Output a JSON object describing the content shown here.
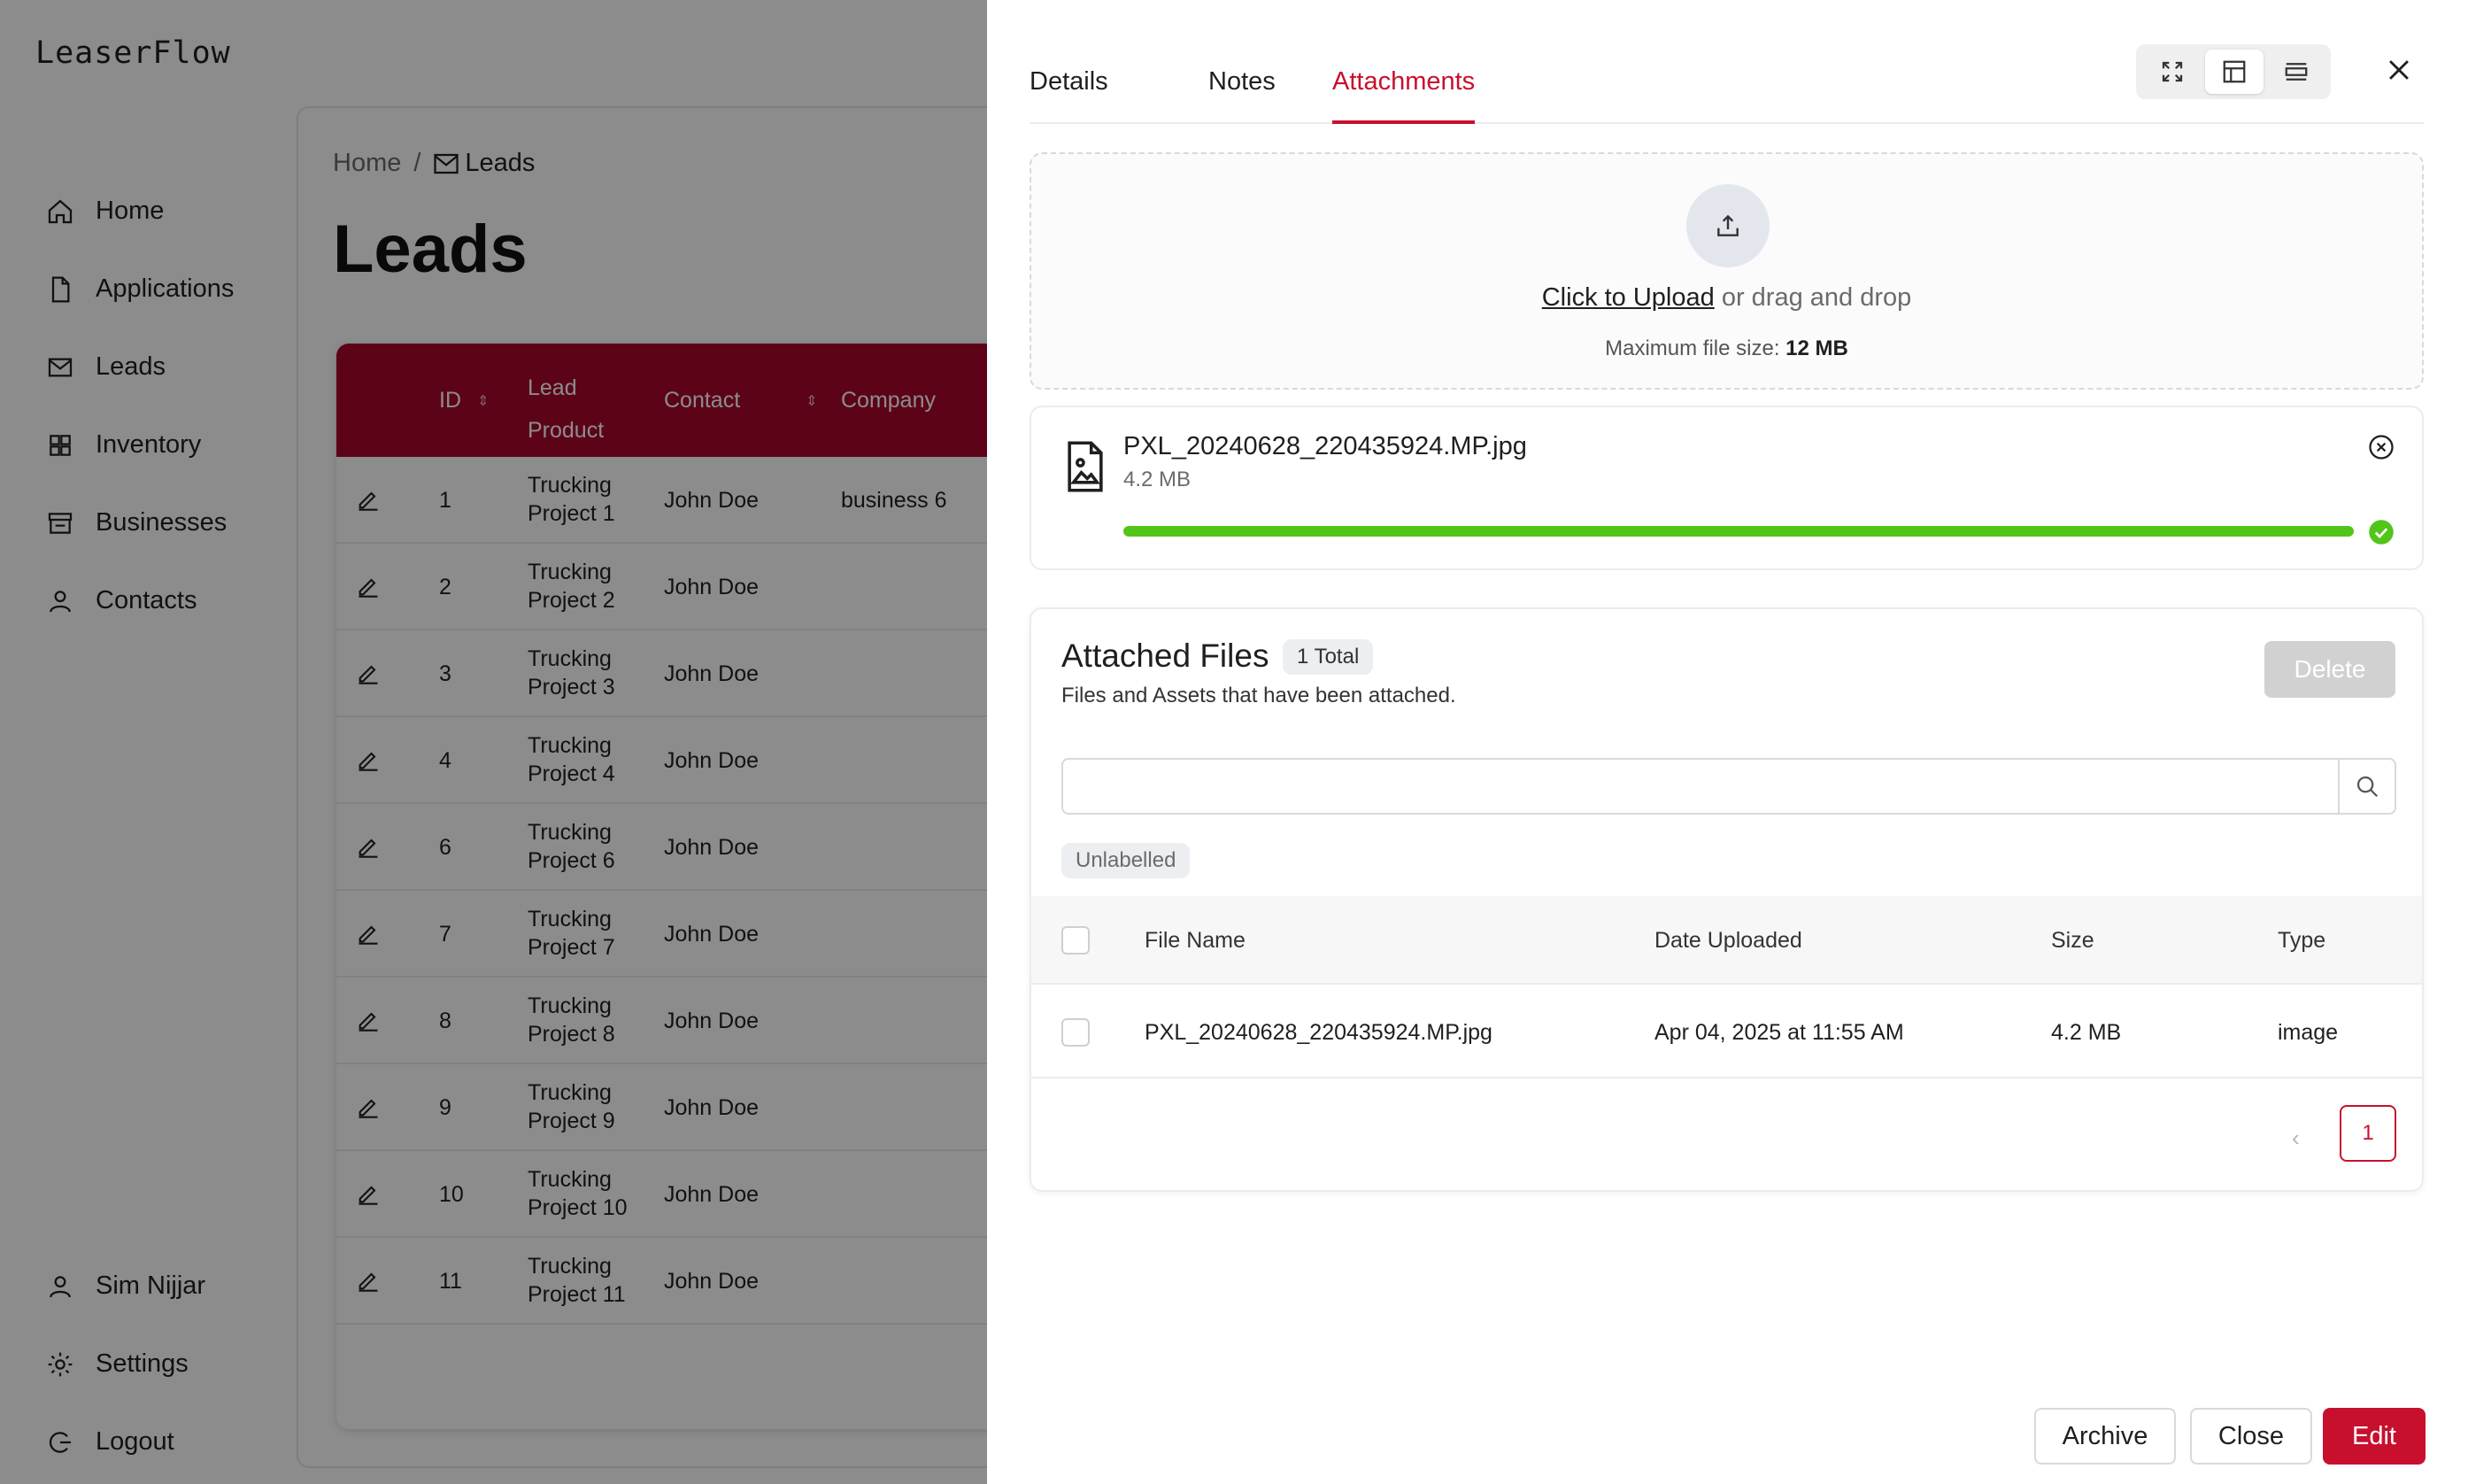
{
  "app": {
    "brand": "LeaserFlow",
    "nav": [
      {
        "label": "Home",
        "icon": "home-icon"
      },
      {
        "label": "Applications",
        "icon": "document-icon"
      },
      {
        "label": "Leads",
        "icon": "mail-icon"
      },
      {
        "label": "Inventory",
        "icon": "grid-icon"
      },
      {
        "label": "Businesses",
        "icon": "store-icon"
      },
      {
        "label": "Contacts",
        "icon": "user-icon"
      }
    ],
    "bottom_nav": [
      {
        "label": "Sim Nijjar",
        "icon": "user-icon"
      },
      {
        "label": "Settings",
        "icon": "gear-icon"
      },
      {
        "label": "Logout",
        "icon": "logout-icon"
      }
    ],
    "breadcrumb": {
      "home": "Home",
      "separator": "/",
      "current": "Leads"
    },
    "page_title": "Leads",
    "table": {
      "header_color": "#a8072d",
      "columns": {
        "id": "ID",
        "lead_product_1": "Lead",
        "lead_product_2": "Product",
        "contact": "Contact",
        "company": "Company"
      },
      "rows": [
        {
          "id": "1",
          "p1": "Trucking",
          "p2": "Project 1",
          "contact": "John Doe",
          "company": "business 6"
        },
        {
          "id": "2",
          "p1": "Trucking",
          "p2": "Project 2",
          "contact": "John Doe",
          "company": ""
        },
        {
          "id": "3",
          "p1": "Trucking",
          "p2": "Project 3",
          "contact": "John Doe",
          "company": ""
        },
        {
          "id": "4",
          "p1": "Trucking",
          "p2": "Project 4",
          "contact": "John Doe",
          "company": ""
        },
        {
          "id": "6",
          "p1": "Trucking",
          "p2": "Project 6",
          "contact": "John Doe",
          "company": ""
        },
        {
          "id": "7",
          "p1": "Trucking",
          "p2": "Project 7",
          "contact": "John Doe",
          "company": ""
        },
        {
          "id": "8",
          "p1": "Trucking",
          "p2": "Project 8",
          "contact": "John Doe",
          "company": ""
        },
        {
          "id": "9",
          "p1": "Trucking",
          "p2": "Project 9",
          "contact": "John Doe",
          "company": ""
        },
        {
          "id": "10",
          "p1": "Trucking",
          "p2": "Project 10",
          "contact": "John Doe",
          "company": ""
        },
        {
          "id": "11",
          "p1": "Trucking",
          "p2": "Project 11",
          "contact": "John Doe",
          "company": ""
        }
      ]
    }
  },
  "drawer": {
    "tabs": [
      "Details",
      "Notes",
      "Attachments"
    ],
    "active_tab": "Attachments",
    "accent": "#c8102e",
    "upload": {
      "link": "Click to Upload",
      "rest": " or drag and drop",
      "max_label": "Maximum file size: ",
      "max_value": "12 MB"
    },
    "uploading_file": {
      "name": "PXL_20240628_220435924.MP.jpg",
      "size": "4.2 MB",
      "progress": 1.0,
      "progress_color": "#52c41a"
    },
    "attached": {
      "title": "Attached Files",
      "badge": "1 Total",
      "subtitle": "Files and Assets that have been attached.",
      "delete_label": "Delete",
      "search_placeholder": "",
      "chip": "Unlabelled",
      "columns": {
        "name": "File Name",
        "date": "Date Uploaded",
        "size": "Size",
        "type": "Type"
      },
      "rows": [
        {
          "name": "PXL_20240628_220435924.MP.jpg",
          "date": "Apr 04, 2025 at 11:55 AM",
          "size": "4.2 MB",
          "type": "image"
        }
      ],
      "pagination": {
        "prev": "‹",
        "current": "1",
        "next": "›"
      }
    },
    "footer": {
      "archive": "Archive",
      "close": "Close",
      "edit": "Edit"
    }
  }
}
